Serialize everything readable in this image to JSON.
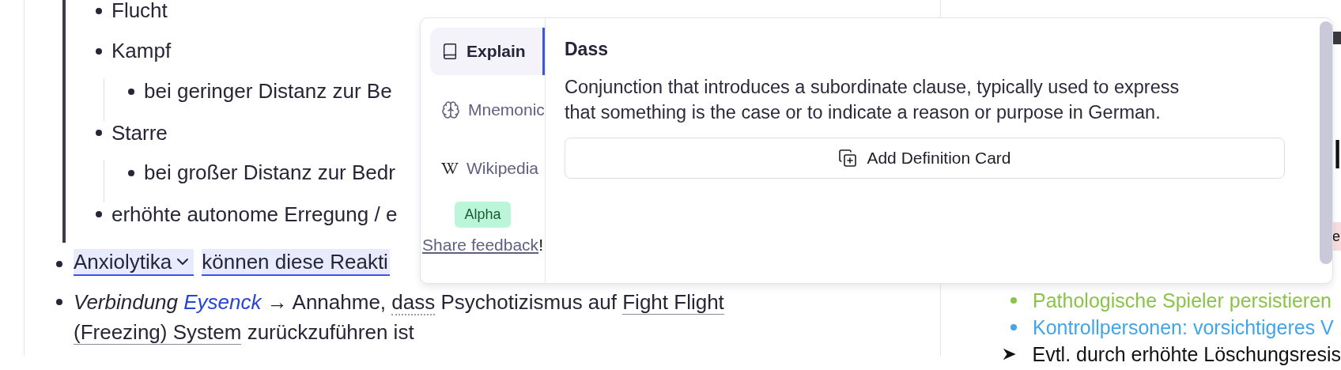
{
  "document": {
    "quote_items": [
      {
        "text": "Flucht"
      },
      {
        "text": "Kampf",
        "children": [
          {
            "text": "bei geringer Distanz zur Be"
          }
        ]
      },
      {
        "text": "Starre",
        "children": [
          {
            "text": "bei großer Distanz zur Bedr"
          }
        ]
      },
      {
        "text": "erhöhte autonome Erregung / e"
      }
    ],
    "items": [
      {
        "kind": "highlight",
        "term": "Anxiolytika",
        "rest": "können diese Reakti"
      },
      {
        "kind": "segments",
        "segments": [
          {
            "kind": "italic",
            "text": "Verbindung"
          },
          {
            "kind": "link",
            "text": "Eysenck"
          },
          {
            "kind": "plain",
            "text": "→ Annahme,"
          },
          {
            "kind": "dotted",
            "text": "dass"
          },
          {
            "kind": "plain",
            "text": "Psychotizismus auf"
          },
          {
            "kind": "underlined",
            "text": "Fight Flight (Freezing) System"
          },
          {
            "kind": "plain",
            "text": "zurückzuführen ist"
          }
        ]
      }
    ]
  },
  "popover": {
    "tabs": [
      {
        "label": "Explain",
        "kind": "book",
        "selected": true
      },
      {
        "label": "Mnemonic",
        "kind": "brain",
        "selected": false
      },
      {
        "label": "Wikipedia",
        "kind": "wiki",
        "selected": false
      }
    ],
    "badge": "Alpha",
    "feedback_link": "Share feedback",
    "feedback_suffix": "!",
    "title": "Dass",
    "definition": "Conjunction that introduces a subordinate clause, typically used to express that something is the case or to indicate a reason or purpose in German.",
    "action": "Add Definition Card"
  },
  "slide": {
    "title_fragment": "l",
    "highlight_fragment": "e",
    "lines": [
      {
        "kind": "bullet",
        "text": "Pathologische Spieler persistieren",
        "color": "#8bc34a"
      },
      {
        "kind": "bullet",
        "text": "Kontrollpersonen: vorsichtigeres V",
        "color": "#41a5e8"
      },
      {
        "kind": "arrow",
        "text": "Evtl. durch erhöhte Löschungsresis"
      }
    ]
  }
}
